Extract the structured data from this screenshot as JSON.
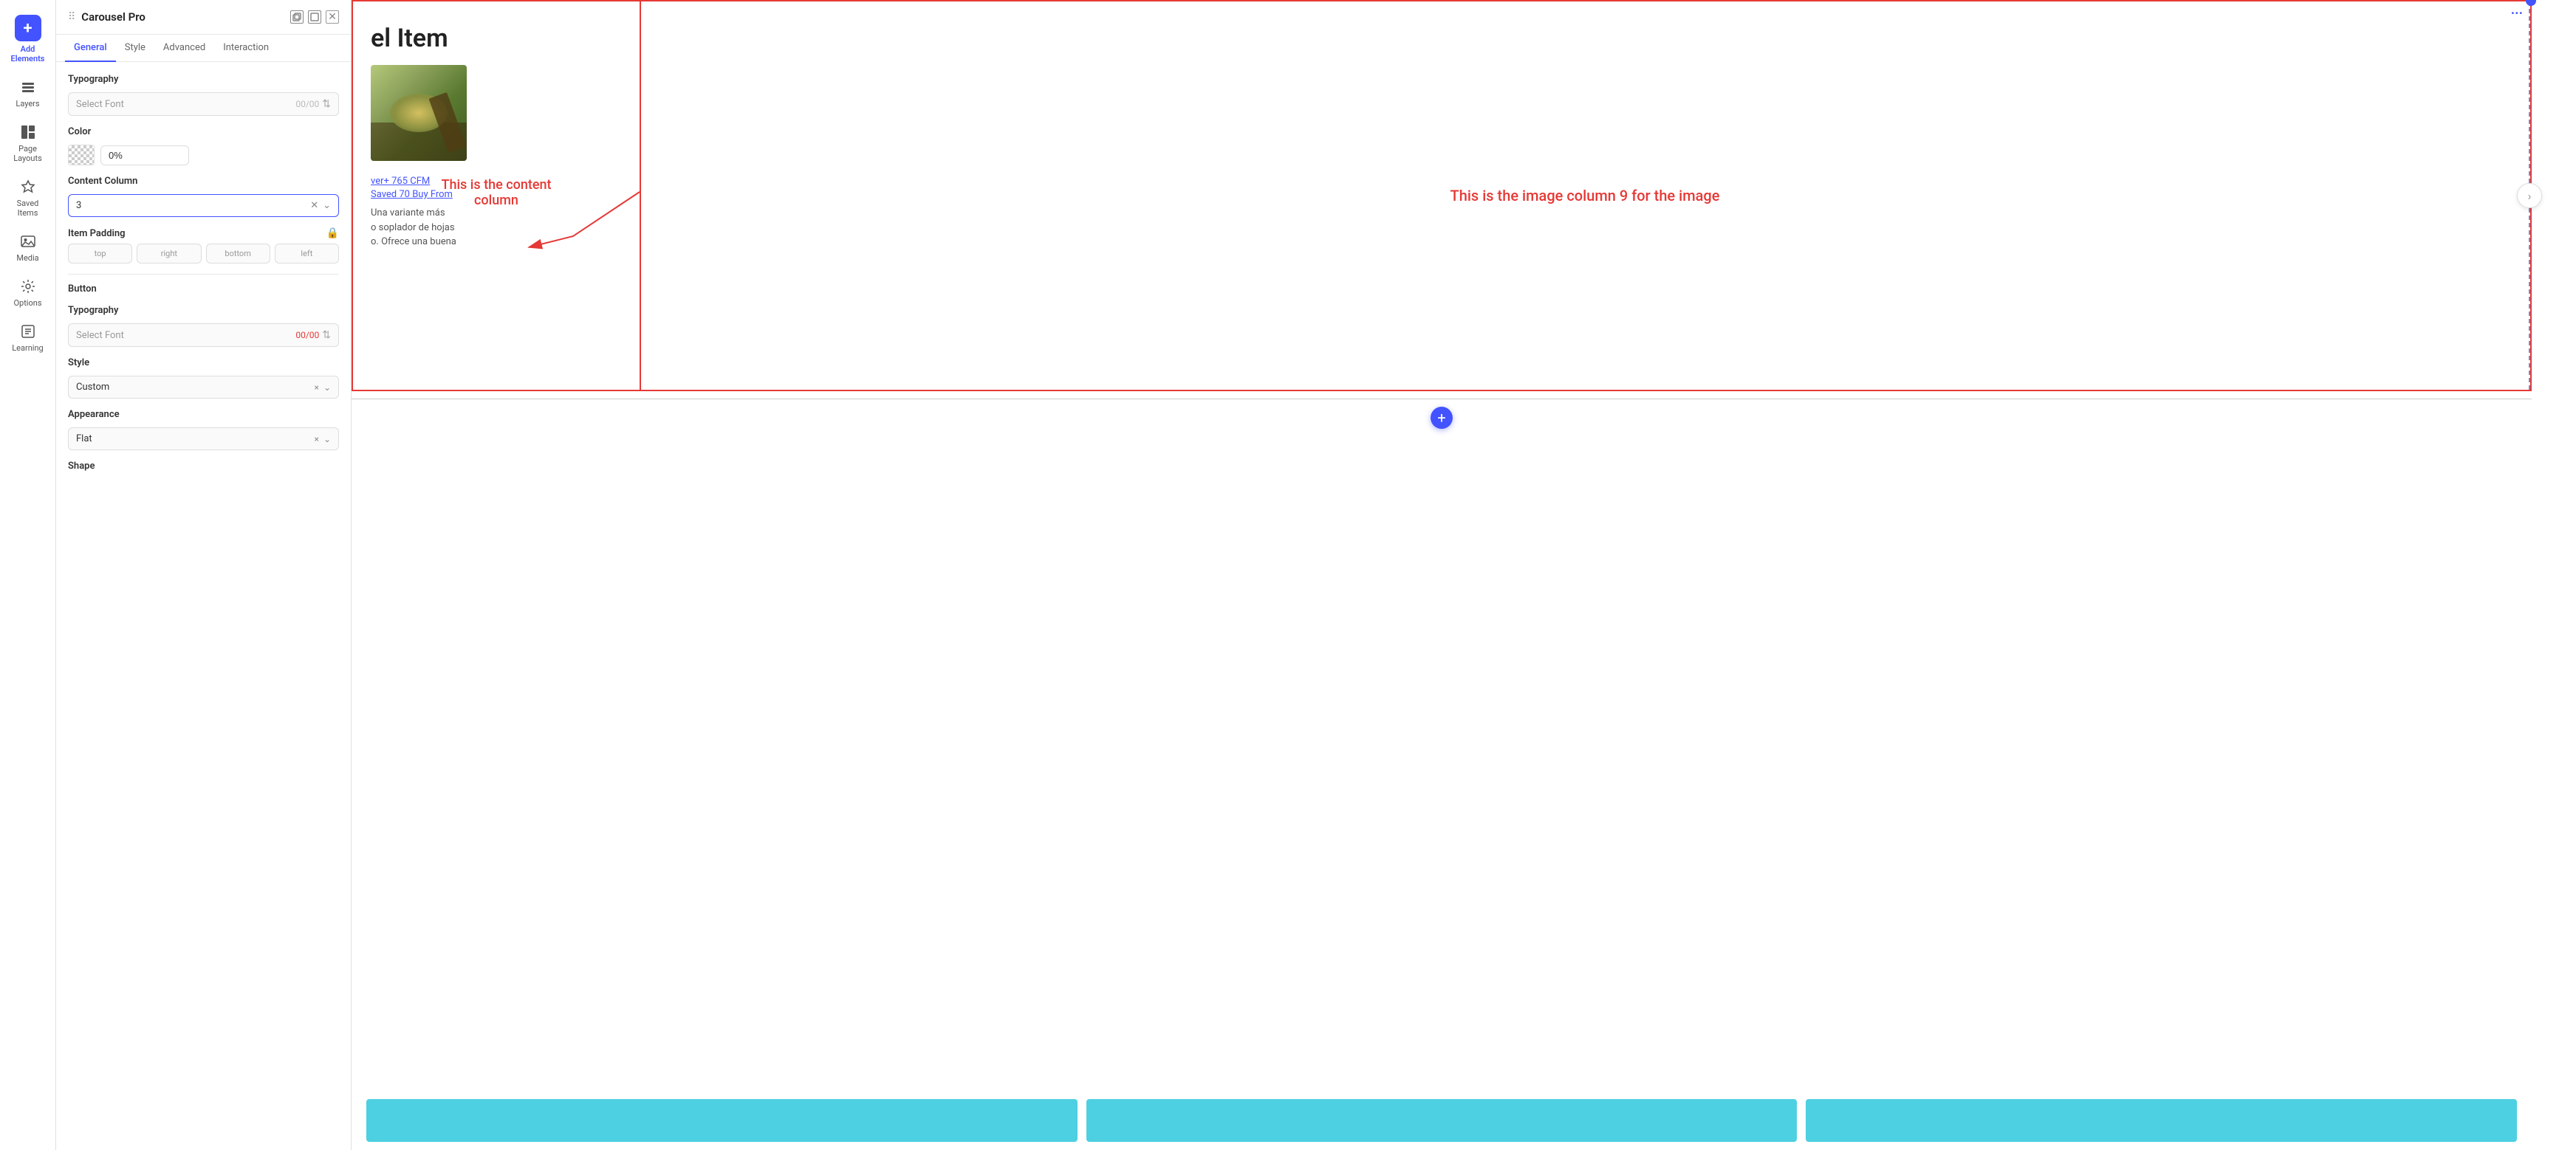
{
  "sidebar": {
    "items": [
      {
        "id": "add-elements",
        "label": "Add Elements",
        "icon": "+",
        "active": false
      },
      {
        "id": "layers",
        "label": "Layers",
        "icon": "⊞",
        "active": false
      },
      {
        "id": "page-layouts",
        "label": "Page Layouts",
        "icon": "⊟",
        "active": false
      },
      {
        "id": "saved-items",
        "label": "Saved Items",
        "icon": "☆",
        "active": false
      },
      {
        "id": "media",
        "label": "Media",
        "icon": "🖼",
        "active": false
      },
      {
        "id": "options",
        "label": "Options",
        "icon": "⚙",
        "active": false
      },
      {
        "id": "learning",
        "label": "Learning",
        "icon": "📖",
        "active": false
      }
    ]
  },
  "panel": {
    "title": "Carousel Pro",
    "tabs": [
      "General",
      "Style",
      "Advanced",
      "Interaction"
    ],
    "active_tab": "General",
    "sections": {
      "typography": {
        "label": "Typography",
        "font_select_placeholder": "Select Font",
        "font_size": "00/00"
      },
      "color": {
        "label": "Color",
        "opacity": "0%"
      },
      "content_column": {
        "label": "Content Column",
        "value": "3"
      },
      "item_padding": {
        "label": "Item Padding",
        "inputs": [
          "top",
          "right",
          "bottom",
          "left"
        ]
      },
      "button": {
        "label": "Button",
        "typography_label": "Typography",
        "font_select_placeholder": "Select Font",
        "font_size": "00/00"
      },
      "style": {
        "label": "Style",
        "value": "Custom",
        "clear": "×",
        "chevron": "⌄"
      },
      "appearance": {
        "label": "Appearance",
        "value": "Flat",
        "clear": "×",
        "chevron": "⌄"
      },
      "shape": {
        "label": "Shape"
      }
    }
  },
  "canvas": {
    "carousel_item_title": "el Item",
    "content_col_label": "This is the content\ncolumn",
    "image_col_label": "This is the image column 9 for the image",
    "product_links": [
      "ver+ 765 CFM",
      "Saved 70 Buy From"
    ],
    "product_desc": "Una variante más\no soplador de hojas\no. Ofrece una buena",
    "add_button_label": "+",
    "arrows": {
      "next_arrow": "›"
    }
  }
}
